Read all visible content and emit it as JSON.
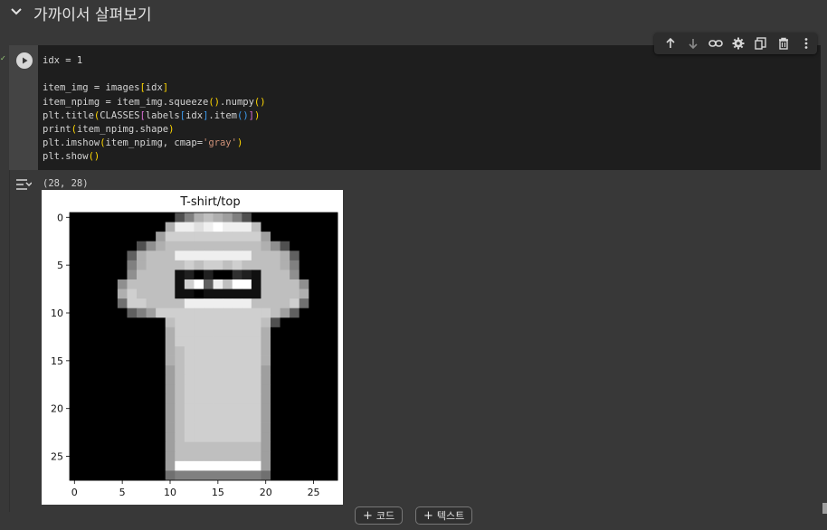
{
  "section": {
    "title": "가까이서 살펴보기"
  },
  "cell": {
    "exec_marker": "✓",
    "code_lines": [
      [
        {
          "t": "idx = 1",
          "c": ""
        }
      ],
      [
        {
          "t": "",
          "c": ""
        }
      ],
      [
        {
          "t": "item_img = images",
          "c": ""
        },
        {
          "t": "[",
          "c": "y"
        },
        {
          "t": "idx",
          "c": ""
        },
        {
          "t": "]",
          "c": "y"
        }
      ],
      [
        {
          "t": "item_npimg = item_img.squeeze",
          "c": ""
        },
        {
          "t": "()",
          "c": "y"
        },
        {
          "t": ".numpy",
          "c": ""
        },
        {
          "t": "()",
          "c": "y"
        }
      ],
      [
        {
          "t": "plt.title",
          "c": ""
        },
        {
          "t": "(",
          "c": "y"
        },
        {
          "t": "CLASSES",
          "c": ""
        },
        {
          "t": "[",
          "c": "p"
        },
        {
          "t": "labels",
          "c": ""
        },
        {
          "t": "[",
          "c": "b"
        },
        {
          "t": "idx",
          "c": ""
        },
        {
          "t": "]",
          "c": "b"
        },
        {
          "t": ".item",
          "c": ""
        },
        {
          "t": "()",
          "c": "b"
        },
        {
          "t": "]",
          "c": "p"
        },
        {
          "t": ")",
          "c": "y"
        }
      ],
      [
        {
          "t": "print",
          "c": ""
        },
        {
          "t": "(",
          "c": "y"
        },
        {
          "t": "item_npimg.shape",
          "c": ""
        },
        {
          "t": ")",
          "c": "y"
        }
      ],
      [
        {
          "t": "plt.imshow",
          "c": ""
        },
        {
          "t": "(",
          "c": "y"
        },
        {
          "t": "item_npimg, cmap=",
          "c": ""
        },
        {
          "t": "'gray'",
          "c": "s"
        },
        {
          "t": ")",
          "c": "y"
        }
      ],
      [
        {
          "t": "plt.show",
          "c": ""
        },
        {
          "t": "()",
          "c": "y"
        }
      ]
    ],
    "toolbar": [
      "arrow-up-icon",
      "arrow-down-icon",
      "link-icon",
      "gear-icon",
      "mirror-cell-icon",
      "trash-icon",
      "more-vert-icon"
    ],
    "output_text": "(28, 28)"
  },
  "chart_data": {
    "type": "heatmap",
    "title": "T-shirt/top",
    "xlabel": "",
    "ylabel": "",
    "colormap": "gray",
    "x_ticks": [
      0,
      5,
      10,
      15,
      20,
      25
    ],
    "y_ticks": [
      0,
      5,
      10,
      15,
      20,
      25
    ],
    "xlim": [
      -0.5,
      27.5
    ],
    "ylim": [
      27.5,
      -0.5
    ],
    "shape": [
      28,
      28
    ],
    "pixels": [
      [
        0,
        0,
        0,
        0,
        0,
        0,
        0,
        0,
        0,
        0,
        0,
        5,
        8,
        11,
        12,
        11,
        10,
        8,
        5,
        0,
        0,
        0,
        0,
        0,
        0,
        0,
        0,
        0
      ],
      [
        0,
        0,
        0,
        0,
        0,
        0,
        0,
        0,
        0,
        0,
        11,
        15,
        15,
        14,
        15,
        16,
        15,
        15,
        15,
        12,
        0,
        0,
        0,
        0,
        0,
        0,
        0,
        0
      ],
      [
        0,
        0,
        0,
        0,
        0,
        0,
        0,
        0,
        0,
        10,
        13,
        13,
        13,
        13,
        13,
        13,
        13,
        13,
        13,
        13,
        10,
        0,
        0,
        0,
        0,
        0,
        0,
        0
      ],
      [
        0,
        0,
        0,
        0,
        0,
        0,
        0,
        5,
        9,
        11,
        12,
        12,
        12,
        12,
        12,
        12,
        12,
        12,
        12,
        12,
        11,
        9,
        5,
        0,
        0,
        0,
        0,
        0
      ],
      [
        0,
        0,
        0,
        0,
        0,
        0,
        6,
        11,
        12,
        12,
        12,
        15,
        15,
        15,
        15,
        15,
        15,
        15,
        15,
        12,
        12,
        12,
        11,
        6,
        0,
        0,
        0,
        0
      ],
      [
        0,
        0,
        0,
        0,
        0,
        0,
        8,
        11,
        12,
        12,
        12,
        12,
        13,
        12,
        13,
        13,
        12,
        13,
        12,
        12,
        12,
        12,
        11,
        8,
        0,
        0,
        0,
        0
      ],
      [
        0,
        0,
        0,
        0,
        0,
        0,
        9,
        12,
        12,
        12,
        12,
        1,
        2,
        0,
        2,
        0,
        0,
        3,
        2,
        1,
        12,
        12,
        12,
        9,
        0,
        0,
        0,
        0
      ],
      [
        0,
        0,
        0,
        0,
        0,
        9,
        12,
        12,
        12,
        12,
        12,
        1,
        13,
        16,
        6,
        15,
        12,
        16,
        16,
        1,
        12,
        12,
        12,
        12,
        9,
        0,
        0,
        0
      ],
      [
        0,
        0,
        0,
        0,
        0,
        11,
        13,
        12,
        12,
        12,
        12,
        1,
        1,
        0,
        1,
        1,
        1,
        1,
        1,
        1,
        12,
        12,
        12,
        12,
        11,
        0,
        0,
        0
      ],
      [
        0,
        0,
        0,
        0,
        0,
        7,
        13,
        13,
        12,
        12,
        12,
        12,
        15,
        15,
        15,
        15,
        15,
        15,
        15,
        12,
        12,
        12,
        12,
        13,
        7,
        0,
        0,
        0
      ],
      [
        0,
        0,
        0,
        0,
        0,
        0,
        6,
        8,
        10,
        13,
        13,
        13,
        13,
        13,
        13,
        13,
        13,
        13,
        13,
        13,
        13,
        12,
        10,
        6,
        0,
        0,
        0,
        0
      ],
      [
        0,
        0,
        0,
        0,
        0,
        0,
        0,
        0,
        0,
        0,
        12,
        13,
        13,
        13,
        13,
        13,
        13,
        13,
        13,
        13,
        12,
        5,
        0,
        0,
        0,
        0,
        0,
        0
      ],
      [
        0,
        0,
        0,
        0,
        0,
        0,
        0,
        0,
        0,
        0,
        11,
        13,
        13,
        13,
        13,
        13,
        13,
        13,
        13,
        13,
        11,
        0,
        0,
        0,
        0,
        0,
        0,
        0
      ],
      [
        0,
        0,
        0,
        0,
        0,
        0,
        0,
        0,
        0,
        0,
        11,
        13,
        13,
        13,
        13,
        13,
        13,
        13,
        13,
        13,
        11,
        0,
        0,
        0,
        0,
        0,
        0,
        0
      ],
      [
        0,
        0,
        0,
        0,
        0,
        0,
        0,
        0,
        0,
        0,
        11,
        12,
        13,
        13,
        13,
        13,
        13,
        13,
        13,
        13,
        11,
        0,
        0,
        0,
        0,
        0,
        0,
        0
      ],
      [
        0,
        0,
        0,
        0,
        0,
        0,
        0,
        0,
        0,
        0,
        11,
        12,
        13,
        13,
        13,
        13,
        13,
        13,
        13,
        13,
        11,
        0,
        0,
        0,
        0,
        0,
        0,
        0
      ],
      [
        0,
        0,
        0,
        0,
        0,
        0,
        0,
        0,
        0,
        0,
        10,
        12,
        13,
        13,
        13,
        13,
        13,
        13,
        13,
        13,
        10,
        0,
        0,
        0,
        0,
        0,
        0,
        0
      ],
      [
        0,
        0,
        0,
        0,
        0,
        0,
        0,
        0,
        0,
        0,
        10,
        12,
        13,
        13,
        13,
        13,
        13,
        13,
        13,
        13,
        10,
        0,
        0,
        0,
        0,
        0,
        0,
        0
      ],
      [
        0,
        0,
        0,
        0,
        0,
        0,
        0,
        0,
        0,
        0,
        10,
        12,
        13,
        13,
        13,
        13,
        13,
        13,
        13,
        13,
        10,
        0,
        0,
        0,
        0,
        0,
        0,
        0
      ],
      [
        0,
        0,
        0,
        0,
        0,
        0,
        0,
        0,
        0,
        0,
        10,
        12,
        13,
        13,
        13,
        13,
        13,
        13,
        13,
        13,
        10,
        0,
        0,
        0,
        0,
        0,
        0,
        0
      ],
      [
        0,
        0,
        0,
        0,
        0,
        0,
        0,
        0,
        0,
        0,
        10,
        12,
        13,
        13,
        13,
        13,
        13,
        13,
        13,
        13,
        10,
        0,
        0,
        0,
        0,
        0,
        0,
        0
      ],
      [
        0,
        0,
        0,
        0,
        0,
        0,
        0,
        0,
        0,
        0,
        10,
        12,
        13,
        13,
        13,
        13,
        13,
        13,
        13,
        13,
        10,
        0,
        0,
        0,
        0,
        0,
        0,
        0
      ],
      [
        0,
        0,
        0,
        0,
        0,
        0,
        0,
        0,
        0,
        0,
        10,
        12,
        13,
        13,
        13,
        13,
        13,
        13,
        13,
        13,
        10,
        0,
        0,
        0,
        0,
        0,
        0,
        0
      ],
      [
        0,
        0,
        0,
        0,
        0,
        0,
        0,
        0,
        0,
        0,
        10,
        12,
        13,
        13,
        13,
        13,
        13,
        13,
        13,
        13,
        10,
        0,
        0,
        0,
        0,
        0,
        0,
        0
      ],
      [
        0,
        0,
        0,
        0,
        0,
        0,
        0,
        0,
        0,
        0,
        10,
        12,
        12,
        12,
        12,
        12,
        12,
        12,
        12,
        12,
        10,
        0,
        0,
        0,
        0,
        0,
        0,
        0
      ],
      [
        0,
        0,
        0,
        0,
        0,
        0,
        0,
        0,
        0,
        0,
        10,
        12,
        12,
        12,
        12,
        12,
        12,
        12,
        12,
        12,
        10,
        0,
        0,
        0,
        0,
        0,
        0,
        0
      ],
      [
        0,
        0,
        0,
        0,
        0,
        0,
        0,
        0,
        0,
        0,
        10,
        16,
        16,
        16,
        16,
        16,
        16,
        16,
        16,
        16,
        10,
        0,
        0,
        0,
        0,
        0,
        0,
        0
      ],
      [
        0,
        0,
        0,
        0,
        0,
        0,
        0,
        0,
        0,
        0,
        7,
        8,
        8,
        8,
        8,
        8,
        8,
        8,
        8,
        8,
        7,
        0,
        0,
        0,
        0,
        0,
        0,
        0
      ]
    ],
    "pixel_scale_max": 16
  },
  "bottom": {
    "add_code": "코드",
    "add_text": "텍스트"
  }
}
